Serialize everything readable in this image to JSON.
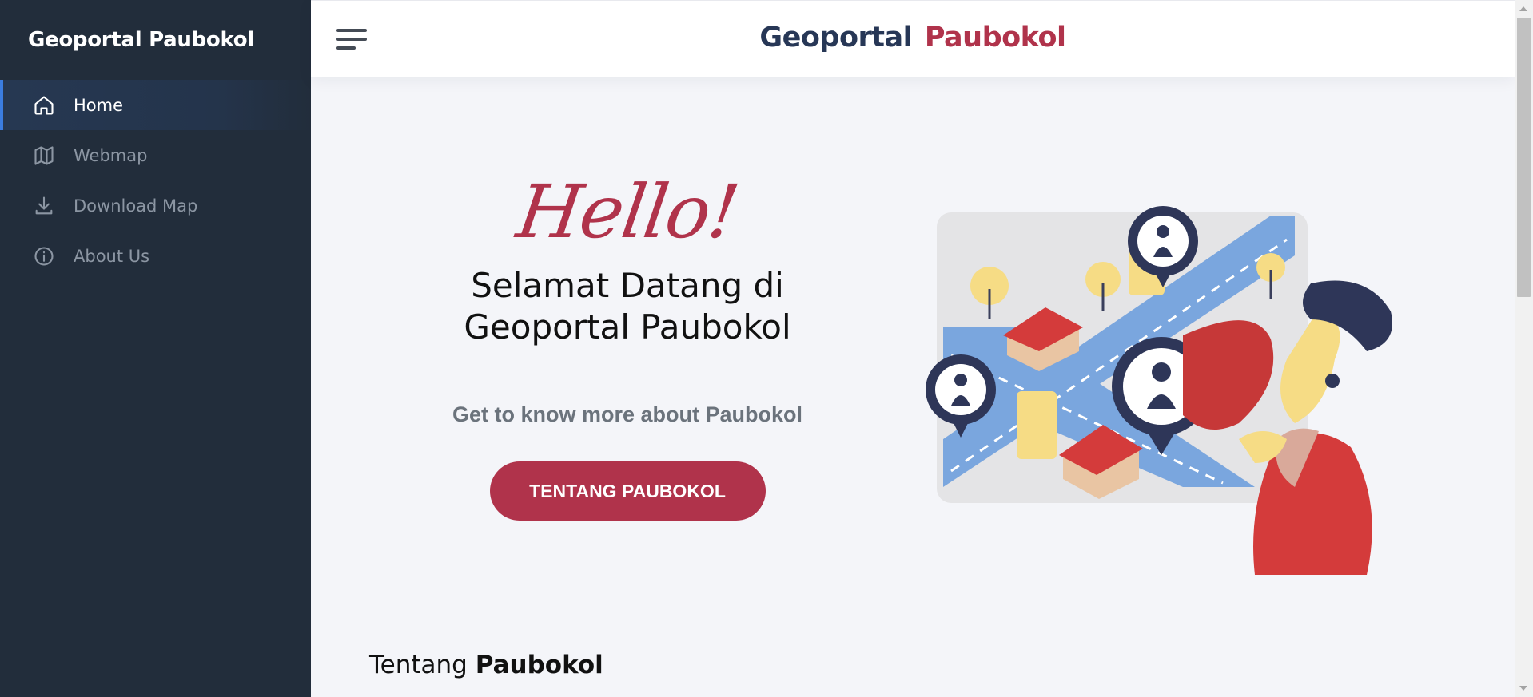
{
  "sidebar": {
    "brand": "Geoportal Paubokol",
    "items": [
      {
        "label": "Home",
        "icon": "home-icon",
        "active": true
      },
      {
        "label": "Webmap",
        "icon": "map-icon",
        "active": false
      },
      {
        "label": "Download Map",
        "icon": "download-icon",
        "active": false
      },
      {
        "label": "About Us",
        "icon": "info-icon",
        "active": false
      }
    ]
  },
  "header": {
    "title_part1": "Geoportal",
    "title_part2": "Paubokol"
  },
  "hero": {
    "greeting": "Hello!",
    "welcome": "Selamat Datang di Geoportal Paubokol",
    "subtitle": "Get to know more about Paubokol",
    "cta_label": "TENTANG PAUBOKOL"
  },
  "section": {
    "title_light": "Tentang",
    "title_bold": "Paubokol"
  },
  "colors": {
    "sidebar_bg": "#222d3b",
    "accent": "#b0334b",
    "navy": "#273756",
    "active_indicator": "#3b7de0"
  }
}
